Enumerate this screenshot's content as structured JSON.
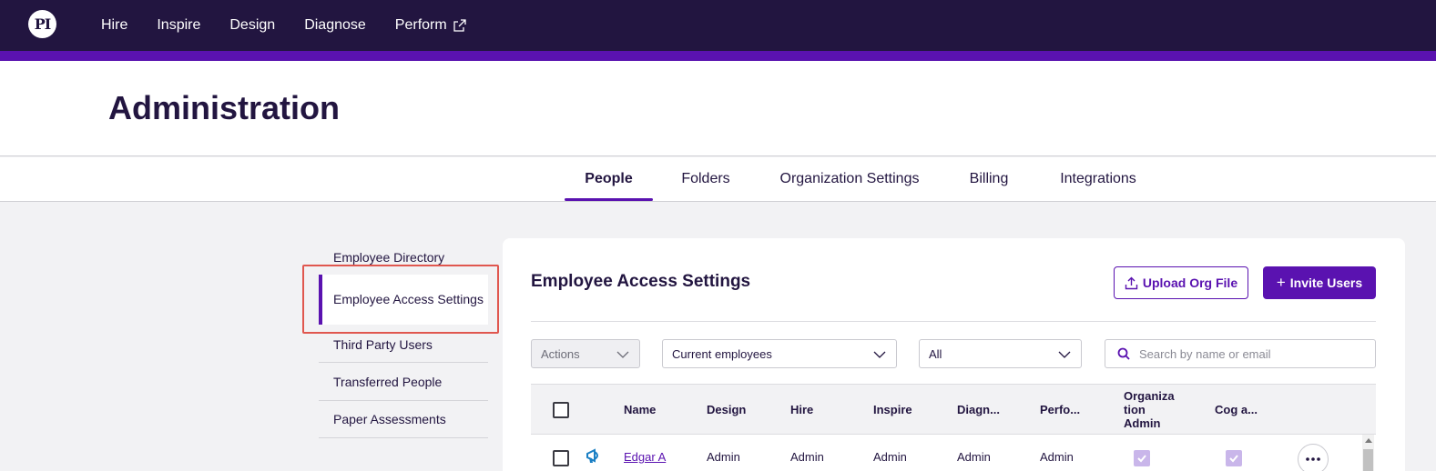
{
  "nav": {
    "logo_text": "PI",
    "links": [
      "Hire",
      "Inspire",
      "Design",
      "Diagnose",
      "Perform"
    ],
    "external_icon": "external-link-icon"
  },
  "header": {
    "title": "Administration"
  },
  "tabs": [
    {
      "label": "People",
      "active": true
    },
    {
      "label": "Folders",
      "active": false
    },
    {
      "label": "Organization Settings",
      "active": false
    },
    {
      "label": "Billing",
      "active": false
    },
    {
      "label": "Integrations",
      "active": false
    }
  ],
  "sidebar": {
    "items": [
      {
        "label": "Employee Directory",
        "active": false
      },
      {
        "label": "Employee Access Settings",
        "active": true
      },
      {
        "label": "Third Party Users",
        "active": false
      },
      {
        "label": "Transferred People",
        "active": false
      },
      {
        "label": "Paper Assessments",
        "active": false
      }
    ]
  },
  "main": {
    "title": "Employee Access Settings",
    "upload_button": "Upload Org File",
    "invite_button": "Invite Users",
    "filters": {
      "actions": "Actions",
      "employees": "Current employees",
      "scope": "All",
      "search_placeholder": "Search by name or email"
    },
    "table": {
      "columns": [
        "Name",
        "Design",
        "Hire",
        "Inspire",
        "Diagn...",
        "Perfo...",
        "Organization Admin",
        "Cog a..."
      ],
      "org_admin_lines": [
        "Organiza",
        "tion",
        "Admin"
      ],
      "rows": [
        {
          "name": "Edgar A",
          "design": "Admin",
          "hire": "Admin",
          "inspire": "Admin",
          "diagnose": "Admin",
          "perform": "Admin",
          "org_admin": true,
          "cog_access": true
        }
      ]
    }
  },
  "colors": {
    "nav_bg": "#221540",
    "accent": "#5a12b0",
    "highlight": "#e0574f"
  }
}
